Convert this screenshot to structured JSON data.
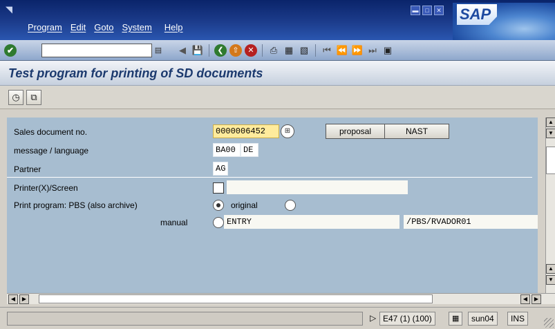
{
  "menu": {
    "items": [
      "Program",
      "Edit",
      "Goto",
      "System",
      "Help"
    ]
  },
  "window_buttons": [
    "minimize",
    "maximize",
    "close"
  ],
  "logo": "SAP",
  "toolbar": {
    "command_field_value": "",
    "icons": [
      "back-icon",
      "save-icon",
      "back-circle-icon",
      "exit-icon",
      "cancel-icon",
      "print-icon",
      "find-icon",
      "find-next-icon",
      "first-page-icon",
      "previous-page-icon",
      "next-page-icon",
      "last-page-icon",
      "create-session-icon"
    ]
  },
  "title": "Test program for printing of SD documents",
  "app_toolbar": {
    "icons": [
      "execute-icon",
      "variant-icon"
    ]
  },
  "form": {
    "sales_doc_label": "Sales document no.",
    "sales_doc_value": "0000006452",
    "message_label": "message / language",
    "message_value": "BA00",
    "language_value": "DE",
    "partner_label": "Partner",
    "partner_value": "AG",
    "printer_label": "Printer(X)/Screen",
    "printer_value": "",
    "print_program_label": "Print program: PBS (also archive)",
    "option_original_label": "original",
    "option_original_selected": true,
    "manual_label": "manual",
    "entry_value": "ENTRY",
    "program_value": "/PBS/RVADOR01"
  },
  "buttons": {
    "proposal": "proposal",
    "nast": "NAST"
  },
  "status": {
    "message": "",
    "session": "E47 (1) (100)",
    "server": "sun04",
    "mode": "INS"
  },
  "colors": {
    "menu_bar": "#0a246a",
    "main_bg": "#a7bdd0",
    "required_field": "#ffeb9c",
    "title_text": "#1c3a6e"
  }
}
